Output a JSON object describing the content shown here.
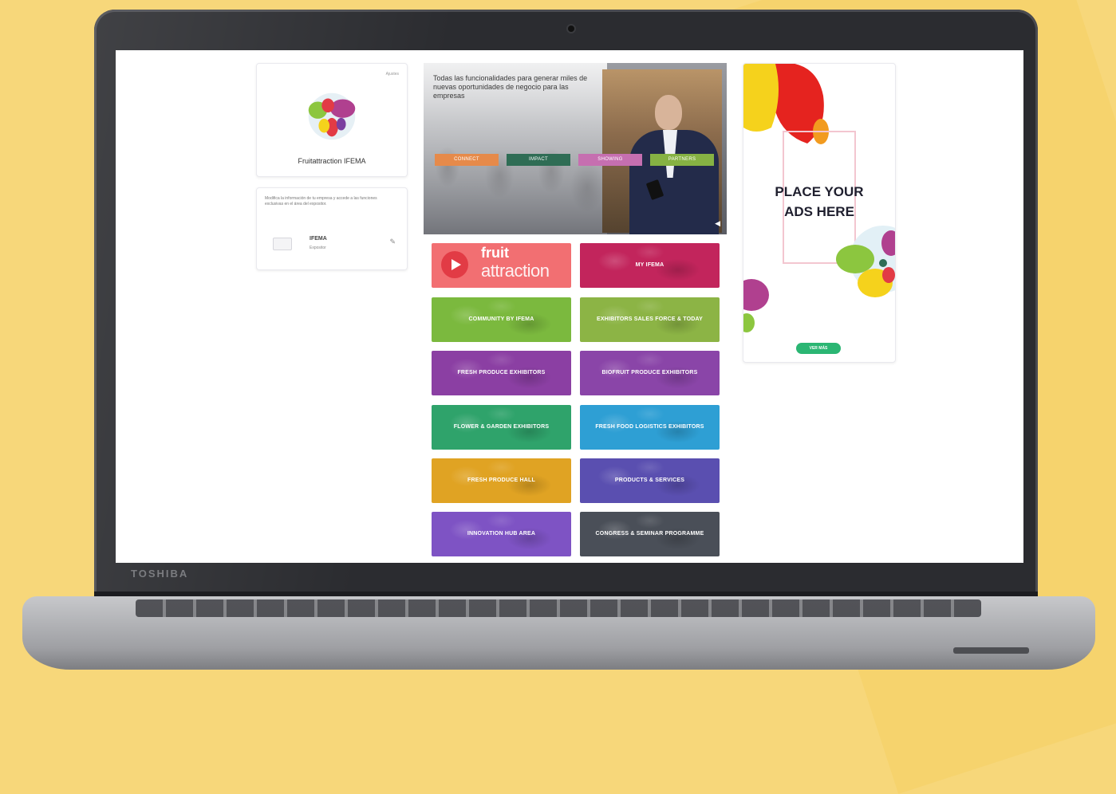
{
  "laptop": {
    "brand": "TOSHIBA"
  },
  "profile": {
    "link_label": "Ajustes",
    "name": "Fruitattraction IFEMA"
  },
  "company": {
    "note": "Modifica la información de tu empresa y accede a las funciones exclusivas en el área del expositor.",
    "name": "IFEMA",
    "role": "Expositor"
  },
  "hero": {
    "text": "Todas las funcionalidades para generar miles de nuevas oportunidades de negocio para las empresas",
    "buttons": [
      {
        "label": "CONNECT",
        "color": "#e68a4a"
      },
      {
        "label": "IMPACT",
        "color": "#2f6d55"
      },
      {
        "label": "SHOWING",
        "color": "#c66fb0"
      },
      {
        "label": "PARTNERS",
        "color": "#86b243"
      }
    ]
  },
  "tiles": [
    {
      "label": "fruit attraction",
      "overlay": "",
      "color": "#f26f72"
    },
    {
      "label": "MY IFEMA",
      "color": "#c2255c"
    },
    {
      "label": "COMMUNITY BY IFEMA",
      "color": "#7bb93e"
    },
    {
      "label": "EXHIBITORS SALES FORCE & TODAY",
      "color": "#8cb445"
    },
    {
      "label": "FRESH PRODUCE EXHIBITORS",
      "color": "#8b3fa3"
    },
    {
      "label": "BIOFRUIT PRODUCE EXHIBITORS",
      "color": "#8a45a8"
    },
    {
      "label": "FLOWER & GARDEN EXHIBITORS",
      "color": "#2fa36b"
    },
    {
      "label": "FRESH FOOD LOGISTICS EXHIBITORS",
      "color": "#2e9fd4"
    },
    {
      "label": "FRESH PRODUCE HALL",
      "color": "#e0a323"
    },
    {
      "label": "PRODUCTS & SERVICES",
      "color": "#5a4fb0"
    },
    {
      "label": "INNOVATION HUB AREA",
      "color": "#7e53c4"
    },
    {
      "label": "CONGRESS & SEMINAR PROGRAMME",
      "color": "#4a4f58"
    }
  ],
  "ad": {
    "title_line1": "PLACE YOUR",
    "title_line2": "ADS HERE",
    "button": "VER MÁS"
  }
}
